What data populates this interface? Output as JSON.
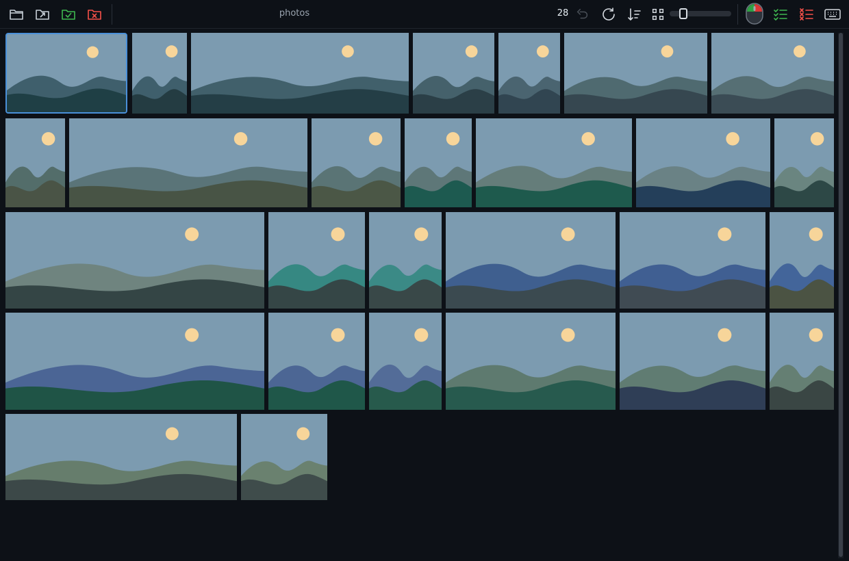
{
  "toolbar": {
    "folder_name": "photos",
    "image_count": "28",
    "zoom_level": 0.25,
    "icons": {
      "open": "folder-open-icon",
      "export": "export-icon",
      "keep": "folder-check-icon",
      "reject": "folder-x-icon",
      "undo": "undo-icon",
      "redo": "redo-icon",
      "sort": "sort-icon",
      "grid": "grid-icon",
      "mouse": "mouse-icon",
      "accept_list": "checklist-icon",
      "reject_list": "rejectlist-icon",
      "keyboard": "keyboard-icon"
    }
  },
  "colors": {
    "background": "#0d1117",
    "accent": "#4a90d9",
    "keep_green": "#3fb950",
    "reject_red": "#f85149",
    "sun": "#f7d59a",
    "sky": "#7c9bb0"
  },
  "thumbnails": [
    {
      "back": "#3f5f6c",
      "front": "#1f3f45",
      "selected": true
    },
    {
      "back": "#3f5f6c",
      "front": "#243c42"
    },
    {
      "back": "#41606b",
      "front": "#243e46"
    },
    {
      "back": "#45616b",
      "front": "#2b3f47"
    },
    {
      "back": "#4a6470",
      "front": "#314551"
    },
    {
      "back": "#4f6a70",
      "front": "#364750"
    },
    {
      "back": "#566f74",
      "front": "#3b4c55"
    },
    {
      "back": "#536d6a",
      "front": "#4a5446"
    },
    {
      "back": "#5a7478",
      "front": "#485445"
    },
    {
      "back": "#5a7475",
      "front": "#4b5746"
    },
    {
      "back": "#5e7778",
      "front": "#1d5a50"
    },
    {
      "back": "#657d7a",
      "front": "#1e5a4d"
    },
    {
      "back": "#6a8285",
      "front": "#243f5a"
    },
    {
      "back": "#6a8580",
      "front": "#2d4846"
    },
    {
      "back": "#6f847f",
      "front": "#344545"
    },
    {
      "back": "#368882",
      "front": "#354646"
    },
    {
      "back": "#3b8a86",
      "front": "#394848"
    },
    {
      "back": "#3f5f8f",
      "front": "#3b4a50"
    },
    {
      "back": "#405f92",
      "front": "#404b53"
    },
    {
      "back": "#43659a",
      "front": "#4b5343"
    },
    {
      "back": "#4b6595",
      "front": "#1f5446"
    },
    {
      "back": "#4c6694",
      "front": "#1f5749"
    },
    {
      "back": "#536c98",
      "front": "#275a4c"
    },
    {
      "back": "#5e7a6f",
      "front": "#275a4e"
    },
    {
      "back": "#607c72",
      "front": "#2f3e56"
    },
    {
      "back": "#657f73",
      "front": "#3a4644"
    },
    {
      "back": "#667d6c",
      "front": "#3c4848"
    },
    {
      "back": "#6a816f",
      "front": "#3f4c4b"
    }
  ]
}
